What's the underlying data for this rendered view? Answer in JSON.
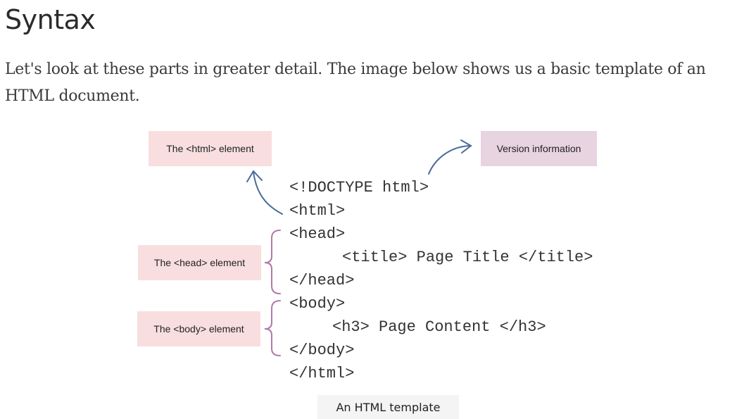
{
  "page": {
    "title": "Syntax",
    "intro": "Let's look at these parts in greater detail. The image below shows us a basic template of an HTML document."
  },
  "figure": {
    "labels": {
      "html_element": "The <html> element",
      "version_info": "Version information",
      "head_element": "The <head> element",
      "body_element": "The <body> element"
    },
    "code": {
      "doctype": "<!DOCTYPE html>",
      "html_open": "<html>",
      "head_open": "<head>",
      "title_line": "<title> Page Title </title>",
      "head_close": "</head>",
      "body_open": "<body>",
      "h3_line": "<h3> Page Content </h3>",
      "body_close": "</body>",
      "html_close": "</html>"
    },
    "caption": "An HTML template",
    "colors": {
      "label_pink": "#f8dedf",
      "label_mauve": "#e8d3e1",
      "arrow_blue": "#4a6b9a",
      "brace_purple": "#b07aa8"
    }
  }
}
